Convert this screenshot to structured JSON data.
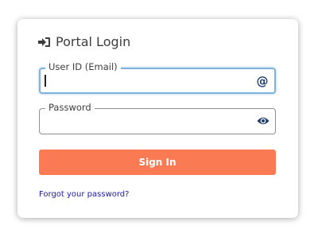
{
  "login": {
    "title": "Portal Login",
    "title_icon": "sign-in-icon",
    "user_field": {
      "label": "User ID (Email)",
      "value": "",
      "icon": "at-icon",
      "icon_glyph": "@"
    },
    "password_field": {
      "label": "Password",
      "value": "",
      "icon": "eye-icon"
    },
    "signin_label": "Sign In",
    "forgot_label": "Forgot your password?"
  },
  "colors": {
    "accent": "#fa7a54",
    "focus_border": "#7fb2dd",
    "link": "#1a1aa6",
    "icon": "#1f3d70"
  }
}
